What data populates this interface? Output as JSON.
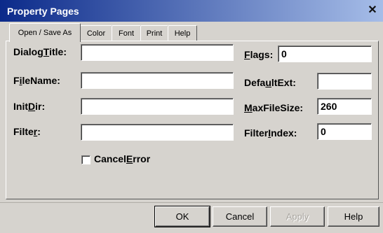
{
  "window": {
    "title": "Property Pages",
    "close_glyph": "✕"
  },
  "tabs": [
    {
      "label": "Open / Save As",
      "active": true
    },
    {
      "label": "Color"
    },
    {
      "label": "Font"
    },
    {
      "label": "Print"
    },
    {
      "label": "Help"
    }
  ],
  "fields": {
    "dialog_title": {
      "label_pre": "Dialog",
      "label_acc": "T",
      "label_post": "itle:",
      "value": ""
    },
    "file_name": {
      "label_pre": "F",
      "label_acc": "i",
      "label_post": "leName:",
      "value": ""
    },
    "init_dir": {
      "label_pre": "Init",
      "label_acc": "D",
      "label_post": "ir:",
      "value": ""
    },
    "filter": {
      "label_pre": "Filte",
      "label_acc": "r",
      "label_post": ":",
      "value": ""
    },
    "flags": {
      "label_pre": "",
      "label_acc": "F",
      "label_post": "lags:",
      "value": "0"
    },
    "default_ext": {
      "label_pre": "Defa",
      "label_acc": "u",
      "label_post": "ltExt:",
      "value": ""
    },
    "max_file_size": {
      "label_pre": "",
      "label_acc": "M",
      "label_post": "axFileSize:",
      "value": "260"
    },
    "filter_index": {
      "label_pre": "Filter",
      "label_acc": "I",
      "label_post": "ndex:",
      "value": "0"
    }
  },
  "cancel_error": {
    "label_pre": "Cancel",
    "label_acc": "E",
    "label_post": "rror",
    "checked": false
  },
  "buttons": {
    "ok": "OK",
    "cancel": "Cancel",
    "apply": "Apply",
    "help": "Help"
  }
}
